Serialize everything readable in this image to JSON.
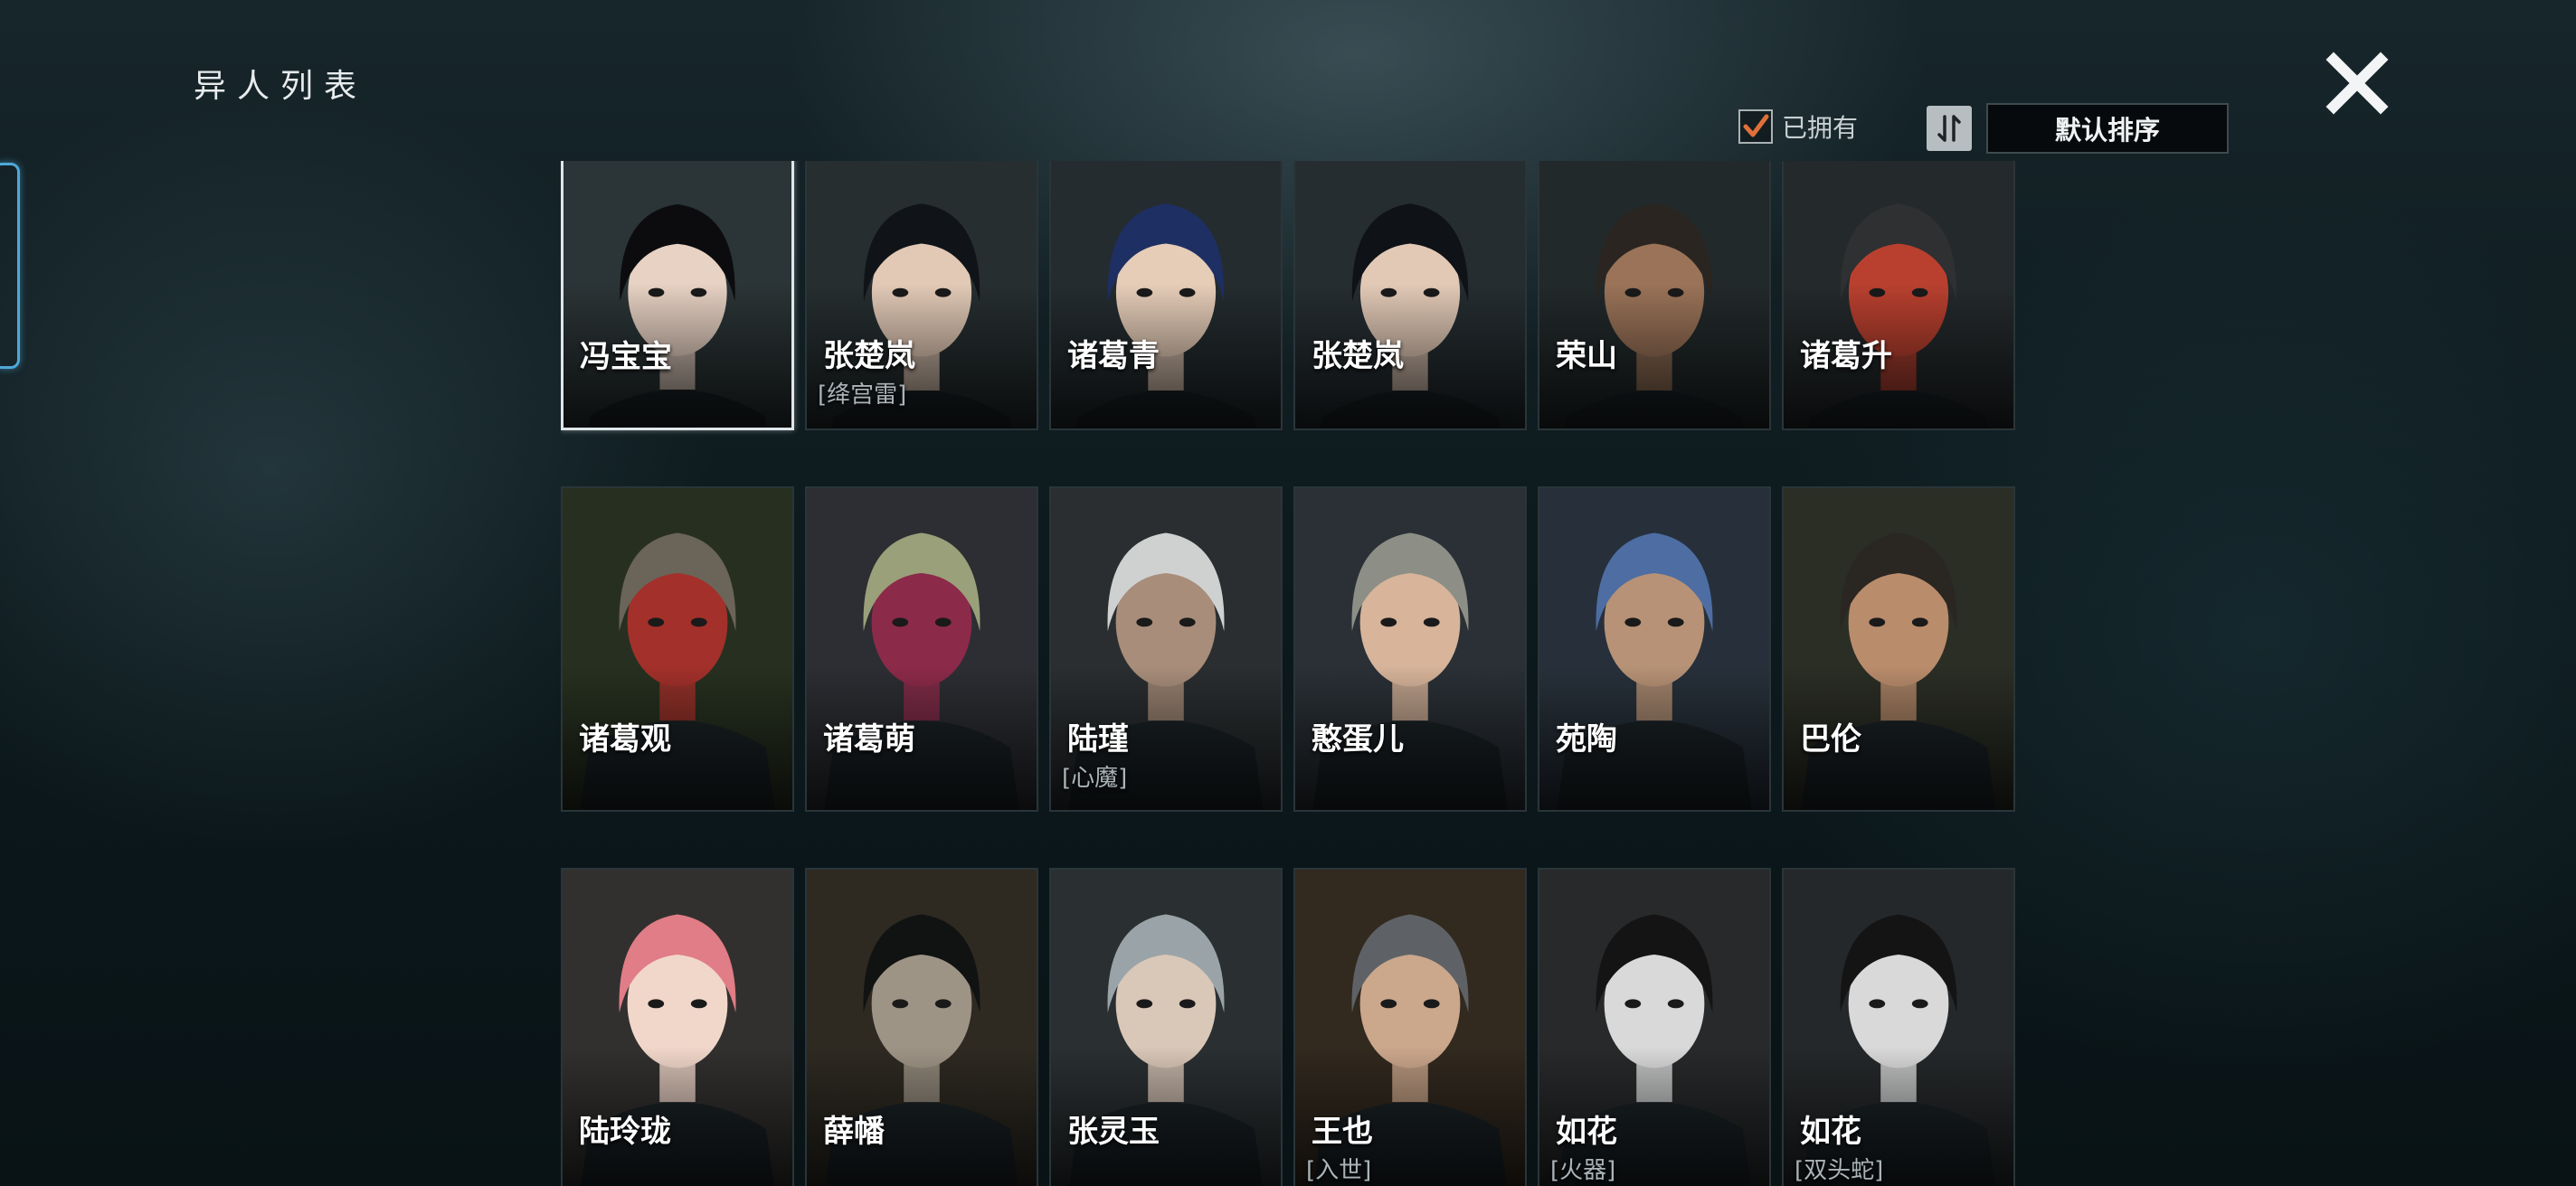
{
  "header": {
    "title": "异人列表",
    "owned_filter_label": "已拥有",
    "sort_label": "默认排序",
    "accent": "#e0703a"
  },
  "characters": [
    {
      "name": "冯宝宝",
      "variant": "",
      "selected": true,
      "hair": "#0c0c0e",
      "skin": "#e8d2c4",
      "bg": "#2b3436"
    },
    {
      "name": "张楚岚",
      "variant": "[绛宫雷]",
      "hair": "#101418",
      "skin": "#e2c9b6",
      "bg": "#262e30"
    },
    {
      "name": "诸葛青",
      "variant": "",
      "hair": "#1e2f63",
      "skin": "#e6cdb8",
      "bg": "#242c2f"
    },
    {
      "name": "张楚岚",
      "variant": "",
      "hair": "#0f1216",
      "skin": "#e2c9b6",
      "bg": "#252d31"
    },
    {
      "name": "荣山",
      "variant": "",
      "hair": "#2a2520",
      "skin": "#9a7358",
      "bg": "#22292b"
    },
    {
      "name": "诸葛升",
      "variant": "",
      "hair": "#2e3032",
      "skin": "#b9402f",
      "bg": "#24292b"
    },
    {
      "name": "诸葛观",
      "variant": "",
      "hair": "#6b6458",
      "skin": "#a3302a",
      "bg": "#273020"
    },
    {
      "name": "诸葛萌",
      "variant": "",
      "hair": "#9aa079",
      "skin": "#8c2a4a",
      "bg": "#2d2e33"
    },
    {
      "name": "陆瑾",
      "variant": "[心魔]",
      "hair": "#cfd1d1",
      "skin": "#a88d7a",
      "bg": "#2a2e30"
    },
    {
      "name": "憨蛋儿",
      "variant": "",
      "hair": "#8d8f86",
      "skin": "#d7b49a",
      "bg": "#2a3036"
    },
    {
      "name": "苑陶",
      "variant": "",
      "hair": "#4d6da3",
      "skin": "#b79276",
      "bg": "#27303a"
    },
    {
      "name": "巴伦",
      "variant": "",
      "hair": "#2a2622",
      "skin": "#b98c6c",
      "bg": "#2b2e25"
    },
    {
      "name": "陆玲珑",
      "variant": "",
      "hair": "#e07d86",
      "skin": "#f1d7ca",
      "bg": "#32302f"
    },
    {
      "name": "薛幡",
      "variant": "",
      "hair": "#111212",
      "skin": "#9e9486",
      "bg": "#2e2a22"
    },
    {
      "name": "张灵玉",
      "variant": "",
      "hair": "#9aa4a8",
      "skin": "#d9c7b8",
      "bg": "#2a2f31"
    },
    {
      "name": "王也",
      "variant": "[入世]",
      "hair": "#5e6266",
      "skin": "#cba78c",
      "bg": "#32291f"
    },
    {
      "name": "如花",
      "variant": "[火器]",
      "hair": "#141414",
      "skin": "#d9d9d9",
      "bg": "#27292a"
    },
    {
      "name": "如花",
      "variant": "[双头蛇]",
      "hair": "#141414",
      "skin": "#d9d9d9",
      "bg": "#25282a"
    }
  ]
}
